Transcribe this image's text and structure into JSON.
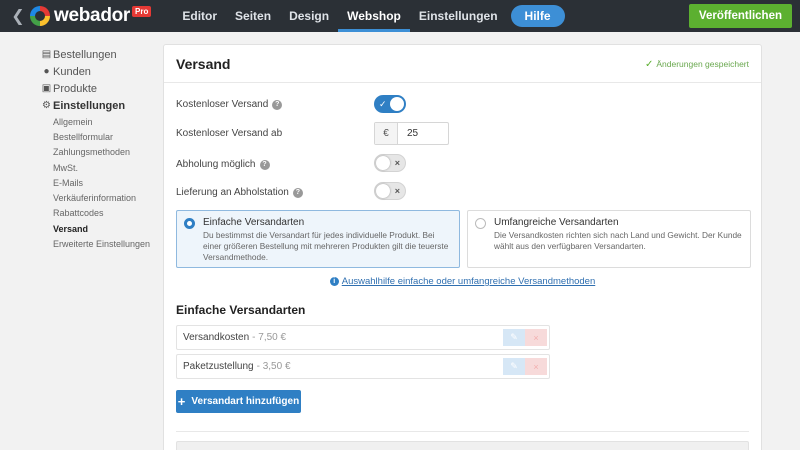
{
  "topbar": {
    "brand": "webador",
    "badge": "Pro",
    "nav": [
      "Editor",
      "Seiten",
      "Design",
      "Webshop",
      "Einstellungen"
    ],
    "help_label": "Hilfe",
    "publish_label": "Veröffentlichen"
  },
  "sidebar": {
    "items": [
      {
        "label": "Bestellungen",
        "icon": "document-icon"
      },
      {
        "label": "Kunden",
        "icon": "person-icon"
      },
      {
        "label": "Produkte",
        "icon": "cart-icon"
      },
      {
        "label": "Einstellungen",
        "icon": "gear-icon"
      }
    ],
    "subitems": [
      "Allgemein",
      "Bestellformular",
      "Zahlungsmethoden",
      "MwSt.",
      "E-Mails",
      "Verkäuferinformation",
      "Rabattcodes",
      "Versand",
      "Erweiterte Einstellungen"
    ]
  },
  "panel": {
    "title": "Versand",
    "saved": "Änderungen gespeichert",
    "free_shipping_label": "Kostenloser Versand",
    "free_shipping_from_label": "Kostenloser Versand ab",
    "currency": "€",
    "free_shipping_from_value": "25",
    "pickup_label": "Abholung möglich",
    "pickup_station_label": "Lieferung an Abholstation",
    "toggles": {
      "free_shipping": true,
      "pickup": false,
      "pickup_station": false
    },
    "options": [
      {
        "title": "Einfache Versandarten",
        "desc": "Du bestimmst die Versandart für jedes individuelle Produkt. Bei einer größeren Bestellung mit mehreren Produkten gilt die teuerste Versandmethode.",
        "selected": true
      },
      {
        "title": "Umfangreiche Versandarten",
        "desc": "Die Versandkosten richten sich nach Land und Gewicht. Der Kunde wählt aus den verfügbaren Versandarten.",
        "selected": false
      }
    ],
    "help_link": "Auswahlhilfe einfache oder umfangreiche Versandmethoden",
    "section_title": "Einfache Versandarten",
    "shipping_methods": [
      {
        "name": "Versandkosten",
        "price": "- 7,50 €"
      },
      {
        "name": "Paketzustellung",
        "price": "- 3,50 €"
      }
    ],
    "add_label": "Versandart hinzufügen"
  },
  "colors": {
    "accent": "#2f7fc4",
    "publish": "#5cb030",
    "topbar": "#2b3036"
  }
}
